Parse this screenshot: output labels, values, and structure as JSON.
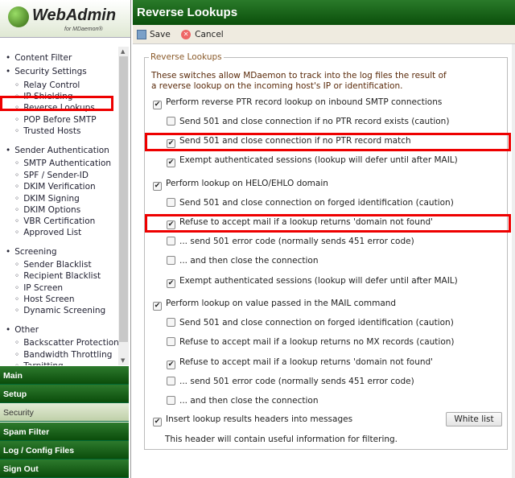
{
  "logo": {
    "text": "WebAdmin",
    "sub": "for MDaemon®"
  },
  "nav": [
    {
      "label": "Content Filter",
      "level": 0
    },
    {
      "label": "Security Settings",
      "level": 0
    },
    {
      "label": "Relay Control",
      "level": 1
    },
    {
      "label": "IP Shielding",
      "level": 1
    },
    {
      "label": "Reverse Lookups",
      "level": 1,
      "selected": true
    },
    {
      "label": "POP Before SMTP",
      "level": 1
    },
    {
      "label": "Trusted Hosts",
      "level": 1
    },
    {
      "label": "Sender Authentication",
      "level": 0
    },
    {
      "label": "SMTP Authentication",
      "level": 1
    },
    {
      "label": "SPF / Sender-ID",
      "level": 1
    },
    {
      "label": "DKIM Verification",
      "level": 1
    },
    {
      "label": "DKIM Signing",
      "level": 1
    },
    {
      "label": "DKIM Options",
      "level": 1
    },
    {
      "label": "VBR Certification",
      "level": 1
    },
    {
      "label": "Approved List",
      "level": 1
    },
    {
      "label": "Screening",
      "level": 0
    },
    {
      "label": "Sender Blacklist",
      "level": 1
    },
    {
      "label": "Recipient Blacklist",
      "level": 1
    },
    {
      "label": "IP Screen",
      "level": 1
    },
    {
      "label": "Host Screen",
      "level": 1
    },
    {
      "label": "Dynamic Screening",
      "level": 1
    },
    {
      "label": "Other",
      "level": 0
    },
    {
      "label": "Backscatter Protection",
      "level": 1
    },
    {
      "label": "Bandwidth Throttling",
      "level": 1
    },
    {
      "label": "Tarpitting",
      "level": 1
    }
  ],
  "tabs": [
    {
      "label": "Main"
    },
    {
      "label": "Setup"
    },
    {
      "label": "Security",
      "active": true
    },
    {
      "label": "Spam Filter"
    },
    {
      "label": "Log / Config Files"
    },
    {
      "label": "Sign Out"
    }
  ],
  "header": {
    "title": "Reverse Lookups"
  },
  "toolbar": {
    "save": "Save",
    "cancel": "Cancel"
  },
  "fieldset": {
    "legend": "Reverse Lookups",
    "description": "These switches allow MDaemon to track into the log files the result of a reverse lookup on the incoming host's IP or identification."
  },
  "options": [
    {
      "label": "Perform reverse PTR record lookup on inbound SMTP connections",
      "level": 0,
      "checked": true
    },
    {
      "label": "Send 501 and close connection if no PTR record exists (caution)",
      "level": 1,
      "checked": false
    },
    {
      "label": "Send 501 and close connection if no PTR record match",
      "level": 1,
      "checked": true,
      "highlighted": true
    },
    {
      "label": "Exempt authenticated sessions (lookup will defer until after MAIL)",
      "level": 1,
      "checked": true
    },
    {
      "label": "Perform lookup on HELO/EHLO domain",
      "level": 0,
      "checked": true
    },
    {
      "label": "Send 501 and close connection on forged identification (caution)",
      "level": 1,
      "checked": false
    },
    {
      "label": "Refuse to accept mail if a lookup returns 'domain not found'",
      "level": 1,
      "checked": true,
      "highlighted": true
    },
    {
      "label": "... send 501 error code (normally sends 451 error code)",
      "level": 1,
      "checked": false
    },
    {
      "label": "... and then close the connection",
      "level": 1,
      "checked": false
    },
    {
      "label": "Exempt authenticated sessions (lookup will defer until after MAIL)",
      "level": 1,
      "checked": true
    },
    {
      "label": "Perform lookup on value passed in the MAIL command",
      "level": 0,
      "checked": true
    },
    {
      "label": "Send 501 and close connection on forged identification (caution)",
      "level": 1,
      "checked": false
    },
    {
      "label": "Refuse to accept mail if a lookup returns no MX records (caution)",
      "level": 1,
      "checked": false
    },
    {
      "label": "Refuse to accept mail if a lookup returns 'domain not found'",
      "level": 1,
      "checked": true
    },
    {
      "label": "... send 501 error code (normally sends 451 error code)",
      "level": 1,
      "checked": false
    },
    {
      "label": "... and then close the connection",
      "level": 1,
      "checked": false
    },
    {
      "label": "Insert lookup results headers into messages",
      "level": 0,
      "checked": true
    }
  ],
  "white_list": "White list",
  "note": "This header will contain useful information for filtering."
}
